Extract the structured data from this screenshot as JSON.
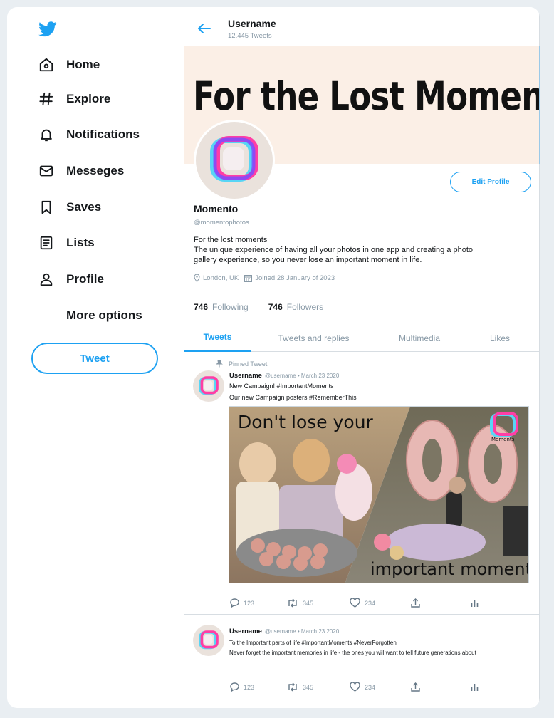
{
  "sidebar": {
    "items": [
      {
        "label": "Home",
        "icon": "home-icon"
      },
      {
        "label": "Explore",
        "icon": "hashtag-icon"
      },
      {
        "label": "Notifications",
        "icon": "bell-icon"
      },
      {
        "label": "Messeges",
        "icon": "envelope-icon"
      },
      {
        "label": "Saves",
        "icon": "bookmark-icon"
      },
      {
        "label": "Lists",
        "icon": "list-icon"
      },
      {
        "label": "Profile",
        "icon": "person-icon"
      },
      {
        "label": "More options",
        "icon": ""
      }
    ],
    "tweet_button": "Tweet"
  },
  "header": {
    "title": "Username",
    "tweet_count": "12.445 Tweets"
  },
  "banner": {
    "text": "For the Lost Moments"
  },
  "profile": {
    "edit_button": "Edit Profile",
    "name": "Momento",
    "handle": "@momentophotos",
    "bio_line1": "For the lost moments",
    "bio_line2": "The unique experience of having all your photos in one app and creating a photo gallery experience, so you never lose an important moment in life.",
    "location": "London, UK",
    "joined": "Joined 28 January of 2023",
    "following_count": "746",
    "following_label": "Following",
    "followers_count": "746",
    "followers_label": "Followers"
  },
  "tabs": [
    "Tweets",
    "Tweets and replies",
    "Multimedia",
    "Likes"
  ],
  "tweets": [
    {
      "pinned_label": "Pinned Tweet",
      "name": "Username",
      "meta": "@username • March 23 2020",
      "line1": "New Campaign! #ImportantMoments",
      "line2": "Our new Campaign posters #RememberThis",
      "media_text_top": "Don't lose your",
      "media_text_bottom": "important moments",
      "media_logo_text": "Moments",
      "replies": "123",
      "retweets": "345",
      "likes": "234"
    },
    {
      "name": "Username",
      "meta": "@username • March 23 2020",
      "line1": "To the Important parts of life #ImportantMoments #NeverForgotten",
      "line2": "Never forget the important memories in life - the ones you will want to tell future generations about",
      "replies": "123",
      "retweets": "345",
      "likes": "234"
    }
  ],
  "colors": {
    "accent": "#1da1f2",
    "muted": "#8899a6",
    "banner_bg": "#fbefe6"
  }
}
